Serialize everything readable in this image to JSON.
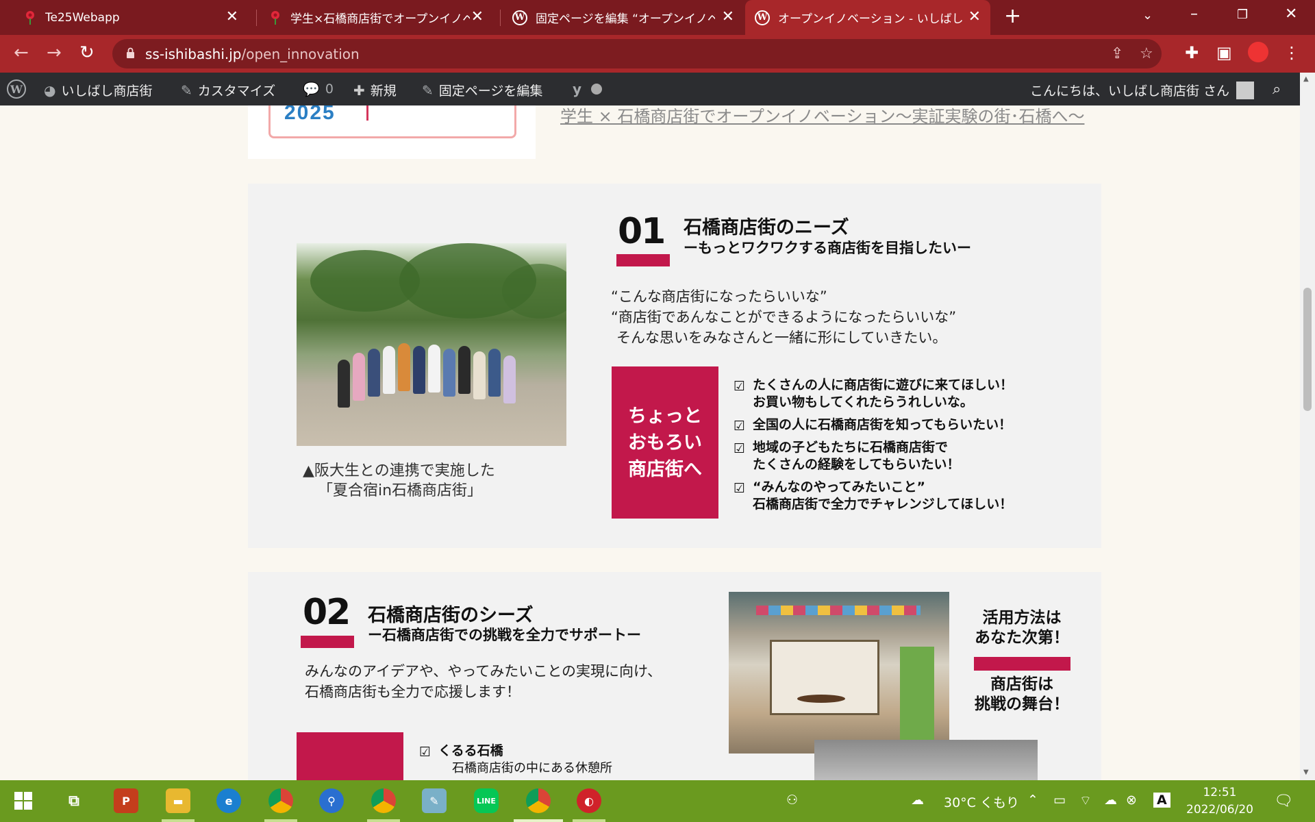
{
  "browser": {
    "tabs": [
      {
        "title": "Te25Webapp",
        "active": false
      },
      {
        "title": "学生×石橋商店街でオープンイノベーシ",
        "active": false
      },
      {
        "title": "固定ページを編集 “オープンイノベーシ",
        "active": false
      },
      {
        "title": "オープンイノベーション - いしばし商店街",
        "active": true
      }
    ],
    "url_host": "ss-ishibashi.jp",
    "url_path": "/open_innovation"
  },
  "admin_bar": {
    "site_name": "いしばし商店街",
    "customize": "カスタマイズ",
    "comments_count": "0",
    "new_label": "新規",
    "edit_page": "固定ページを編集",
    "greeting": "こんにちは、いしばし商店街 さん"
  },
  "top": {
    "logo_year": "2025",
    "link_text": "学生 × 石橋商店街でオープンイノベーション～実証実験の街･石橋へ～"
  },
  "section1": {
    "number": "01",
    "title": "石橋商店街のニーズ",
    "subtitle": "ーもっとワクワクする商店街を目指したいー",
    "quote_lines": [
      "“こんな商店街になったらいいな”",
      "“商店街であんなことができるようになったらいいな”",
      " そんな思いをみなさんと一緒に形にしていきたい。"
    ],
    "caption_lines": [
      "▲阪大生との連携で実施した",
      "「夏合宿in石橋商店街」"
    ],
    "pink_box_lines": [
      "ちょっと",
      "おもろい",
      "商店街へ"
    ],
    "checklist": [
      {
        "lines": [
          "たくさんの人に商店街に遊びに来てほしい！",
          " お買い物もしてくれたらうれしいな。"
        ]
      },
      {
        "lines": [
          "全国の人に石橋商店街を知ってもらいたい！"
        ]
      },
      {
        "lines": [
          "地域の子どもたちに石橋商店街で",
          "たくさんの経験をしてもらいたい！"
        ]
      },
      {
        "lines": [
          "“みんなのやってみたいこと”",
          "石橋商店街で全力でチャレンジしてほしい！"
        ]
      }
    ]
  },
  "section2": {
    "number": "02",
    "title": "石橋商店街のシーズ",
    "subtitle": "ー石橋商店街での挑戦を全力でサポートー",
    "body_lines": [
      "みんなのアイデアや、やってみたいことの実現に向け、",
      "石橋商店街も全力で応援します！"
    ],
    "check_title": "くるる石橋",
    "check_desc": "石橋商店街の中にある休憩所",
    "side_top": [
      "活用方法は",
      "あなた次第！"
    ],
    "side_bottom": [
      "商店街は",
      "挑戦の舞台！"
    ]
  },
  "taskbar": {
    "weather": "30°C くもり",
    "time": "12:51",
    "date": "2022/06/20"
  },
  "colors": {
    "tab_strip": "#7a1a1f",
    "toolbar": "#a8272a",
    "accent": "#c2184b",
    "taskbar": "#6a9a1f"
  }
}
